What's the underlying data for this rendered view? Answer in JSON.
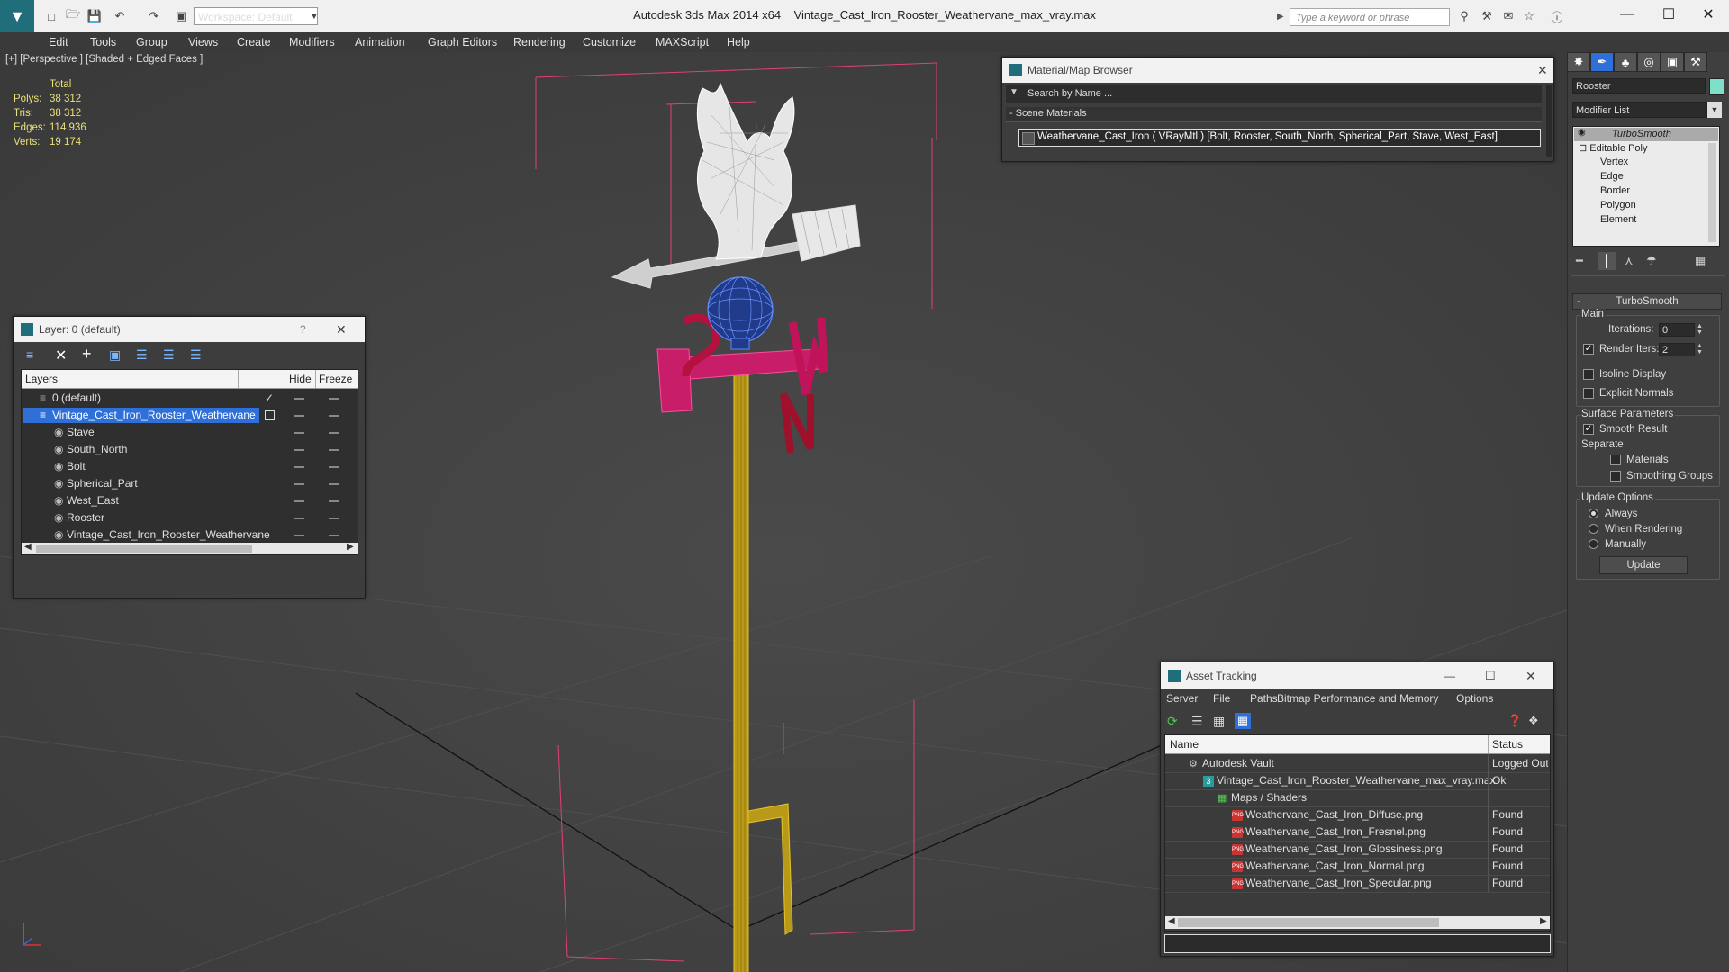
{
  "titlebar": {
    "workspace": "Workspace: Default",
    "app_name": "Autodesk 3ds Max  2014 x64",
    "file_name": "Vintage_Cast_Iron_Rooster_Weathervane_max_vray.max",
    "search_placeholder": "Type a keyword or phrase"
  },
  "menu": [
    "Edit",
    "Tools",
    "Group",
    "Views",
    "Create",
    "Modifiers",
    "Animation",
    "Graph Editors",
    "Rendering",
    "Customize",
    "MAXScript",
    "Help"
  ],
  "viewport": {
    "label": "[+] [Perspective ] [Shaded + Edged Faces ]",
    "stats": {
      "header": "Total",
      "rows": [
        {
          "label": "Polys:",
          "value": "38 312"
        },
        {
          "label": "Tris:",
          "value": "38 312"
        },
        {
          "label": "Edges:",
          "value": "114 936"
        },
        {
          "label": "Verts:",
          "value": "19 174"
        }
      ]
    }
  },
  "layer_panel": {
    "title": "Layer: 0 (default)",
    "help": "?",
    "columns": {
      "layers": "Layers",
      "hide": "Hide",
      "freeze": "Freeze"
    },
    "rows": [
      {
        "name": "0 (default)",
        "level": 1
      },
      {
        "name": "Vintage_Cast_Iron_Rooster_Weathervane",
        "level": 1,
        "selected": true
      },
      {
        "name": "Stave",
        "level": 2
      },
      {
        "name": "South_North",
        "level": 2
      },
      {
        "name": "Bolt",
        "level": 2
      },
      {
        "name": "Spherical_Part",
        "level": 2
      },
      {
        "name": "West_East",
        "level": 2
      },
      {
        "name": "Rooster",
        "level": 2
      },
      {
        "name": "Vintage_Cast_Iron_Rooster_Weathervane",
        "level": 2
      }
    ]
  },
  "material_browser": {
    "title": "Material/Map Browser",
    "search": "Search by Name ...",
    "section": "- Scene Materials",
    "item": "Weathervane_Cast_Iron  ( VRayMtl )  [Bolt, Rooster, South_North, Spherical_Part, Stave, West_East]"
  },
  "asset_tracking": {
    "title": "Asset Tracking",
    "menu": [
      "Server",
      "File",
      "Paths",
      "Bitmap Performance and Memory",
      "Options"
    ],
    "columns": {
      "name": "Name",
      "status": "Status"
    },
    "rows": [
      {
        "name": "Autodesk Vault",
        "status": "Logged Out",
        "indent": 1,
        "icon": "vault"
      },
      {
        "name": "Vintage_Cast_Iron_Rooster_Weathervane_max_vray.max",
        "status": "Ok",
        "indent": 2,
        "icon": "max"
      },
      {
        "name": "Maps / Shaders",
        "status": "",
        "indent": 3,
        "icon": "maps"
      },
      {
        "name": "Weathervane_Cast_Iron_Diffuse.png",
        "status": "Found",
        "indent": 4,
        "icon": "png"
      },
      {
        "name": "Weathervane_Cast_Iron_Fresnel.png",
        "status": "Found",
        "indent": 4,
        "icon": "png"
      },
      {
        "name": "Weathervane_Cast_Iron_Glossiness.png",
        "status": "Found",
        "indent": 4,
        "icon": "png"
      },
      {
        "name": "Weathervane_Cast_Iron_Normal.png",
        "status": "Found",
        "indent": 4,
        "icon": "png"
      },
      {
        "name": "Weathervane_Cast_Iron_Specular.png",
        "status": "Found",
        "indent": 4,
        "icon": "png"
      }
    ]
  },
  "command_panel": {
    "object_name": "Rooster",
    "object_color": "#7ee0c8",
    "modifier_list": "Modifier List",
    "stack": [
      "TurboSmooth",
      "Editable Poly",
      "Vertex",
      "Edge",
      "Border",
      "Polygon",
      "Element"
    ],
    "rollout_title": "TurboSmooth",
    "main_label": "Main",
    "iterations_label": "Iterations:",
    "iterations_value": "0",
    "render_iters_label": "Render Iters:",
    "render_iters_value": "2",
    "isoline": "Isoline Display",
    "explicit_normals": "Explicit Normals",
    "surface_params": "Surface Parameters",
    "smooth_result": "Smooth Result",
    "separate": "Separate",
    "materials": "Materials",
    "smoothing_groups": "Smoothing Groups",
    "update_options": "Update Options",
    "always": "Always",
    "when_rendering": "When Rendering",
    "manually": "Manually",
    "update_button": "Update"
  }
}
